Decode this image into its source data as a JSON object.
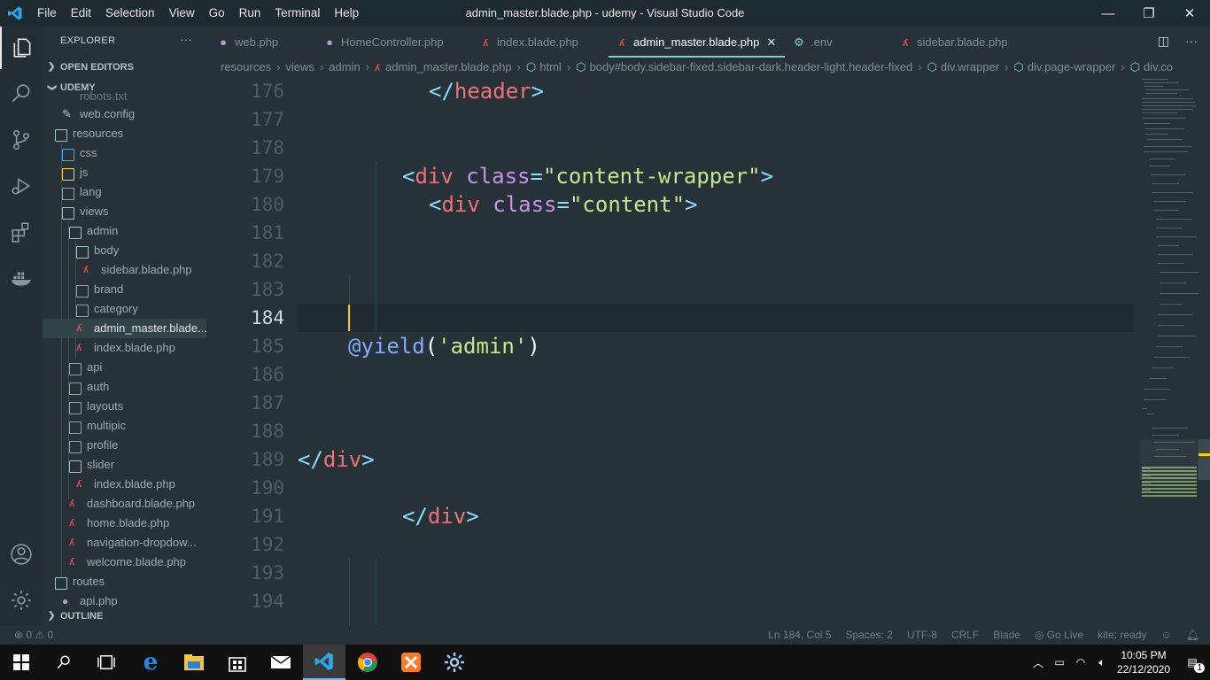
{
  "titlebar": {
    "menu": [
      "File",
      "Edit",
      "Selection",
      "View",
      "Go",
      "Run",
      "Terminal",
      "Help"
    ],
    "title": "admin_master.blade.php - udemy - Visual Studio Code",
    "controls": {
      "minimize": "—",
      "restore": "❐",
      "close": "✕"
    }
  },
  "sidebar": {
    "header": "EXPLORER",
    "more": "···",
    "open_editors": "OPEN EDITORS",
    "workspace": "UDEMY",
    "outline": "OUTLINE",
    "items": [
      {
        "label": "robots.txt",
        "type": "file"
      },
      {
        "label": "web.config",
        "type": "config"
      },
      {
        "label": "resources",
        "type": "folder"
      },
      {
        "label": "css",
        "type": "folder"
      },
      {
        "label": "js",
        "type": "folder"
      },
      {
        "label": "lang",
        "type": "folder"
      },
      {
        "label": "views",
        "type": "folder"
      },
      {
        "label": "admin",
        "type": "folder"
      },
      {
        "label": "body",
        "type": "folder"
      },
      {
        "label": "sidebar.blade.php",
        "type": "blade"
      },
      {
        "label": "brand",
        "type": "folder"
      },
      {
        "label": "category",
        "type": "folder"
      },
      {
        "label": "admin_master.blade...",
        "type": "blade"
      },
      {
        "label": "index.blade.php",
        "type": "blade"
      },
      {
        "label": "api",
        "type": "folder"
      },
      {
        "label": "auth",
        "type": "folder"
      },
      {
        "label": "layouts",
        "type": "folder"
      },
      {
        "label": "multipic",
        "type": "folder"
      },
      {
        "label": "profile",
        "type": "folder"
      },
      {
        "label": "slider",
        "type": "folder"
      },
      {
        "label": "index.blade.php",
        "type": "blade"
      },
      {
        "label": "dashboard.blade.php",
        "type": "blade"
      },
      {
        "label": "home.blade.php",
        "type": "blade"
      },
      {
        "label": "navigation-dropdow...",
        "type": "blade"
      },
      {
        "label": "welcome.blade.php",
        "type": "blade"
      },
      {
        "label": "routes",
        "type": "folder"
      },
      {
        "label": "api.php",
        "type": "php"
      }
    ]
  },
  "tabs": [
    {
      "label": "web.php",
      "icon": "php-elephant-icon"
    },
    {
      "label": "HomeController.php",
      "icon": "php-elephant-icon"
    },
    {
      "label": "index.blade.php",
      "icon": "laravel-icon"
    },
    {
      "label": "admin_master.blade.php",
      "icon": "laravel-icon",
      "active": true
    },
    {
      "label": ".env",
      "icon": "gear-icon"
    },
    {
      "label": "sidebar.blade.php",
      "icon": "laravel-icon"
    }
  ],
  "breadcrumbs": [
    "resources",
    "views",
    "admin",
    "admin_master.blade.php",
    "html",
    "body#body.sidebar-fixed.sidebar-dark.header-light.header-fixed",
    "div.wrapper",
    "div.page-wrapper",
    "div.co"
  ],
  "editor": {
    "line_numbers": [
      "176",
      "177",
      "178",
      "179",
      "180",
      "181",
      "182",
      "183",
      "184",
      "185",
      "186",
      "187",
      "188",
      "189",
      "190",
      "191",
      "192",
      "193",
      "194"
    ],
    "current_line": "184",
    "code": {
      "l176_open": "</",
      "l176_tag": "header",
      "l176_close": ">",
      "l179_open": "<",
      "l179_tag": "div",
      "l179_attr": " class",
      "l179_eq": "=",
      "l179_str": "\"content-wrapper\"",
      "l179_close": ">",
      "l180_open": "<",
      "l180_tag": "div",
      "l180_attr": " class",
      "l180_eq": "=",
      "l180_str": "\"content\"",
      "l180_close": ">",
      "l185_dir": "@yield",
      "l185_p1": "(",
      "l185_str": "'admin'",
      "l185_p2": ")",
      "l189_open": "</",
      "l189_tag": "div",
      "l189_close": ">",
      "l191_open": "</",
      "l191_tag": "div",
      "l191_close": ">"
    }
  },
  "statusbar": {
    "problems": "⊗ 0 ⚠ 0",
    "position": "Ln 184, Col 5",
    "spaces": "Spaces: 2",
    "encoding": "UTF-8",
    "eol": "CRLF",
    "language": "Blade",
    "golive": "Go Live",
    "kite": "kite: ready"
  },
  "taskbar": {
    "time": "10:05 PM",
    "date": "22/12/2020",
    "notifications": "1"
  },
  "colors": {
    "editor_bg": "#263238",
    "accent": "#80cbc4",
    "cursor": "#ffcc00",
    "tag": "#f07178",
    "attr": "#c792ea",
    "string": "#c3e88d"
  }
}
